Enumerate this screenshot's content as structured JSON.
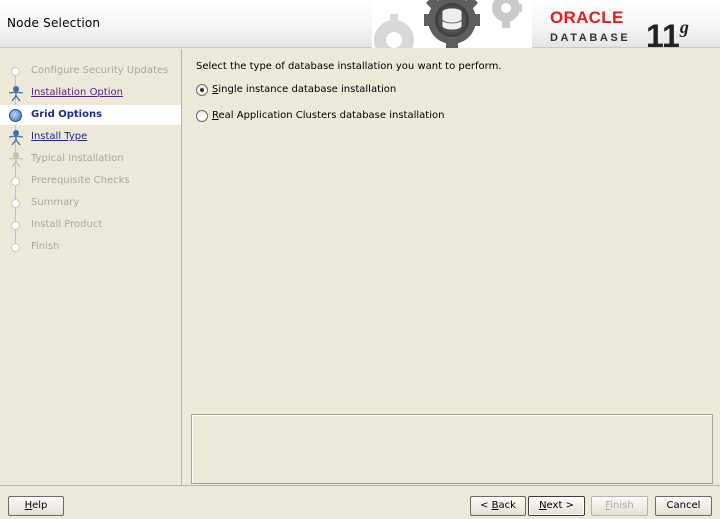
{
  "window": {
    "title": "Node Selection"
  },
  "brand": {
    "oracle": "ORACLE",
    "database": "DATABASE",
    "version": "11",
    "version_suffix": "g"
  },
  "nav": {
    "items": [
      {
        "label": "Configure Security Updates",
        "state": "disabled"
      },
      {
        "label": "Installation Option",
        "state": "visited"
      },
      {
        "label": "Grid Options",
        "state": "current"
      },
      {
        "label": "Install Type",
        "state": "link"
      },
      {
        "label": "Typical Installation",
        "state": "disabled"
      },
      {
        "label": "Prerequisite Checks",
        "state": "disabled"
      },
      {
        "label": "Summary",
        "state": "disabled"
      },
      {
        "label": "Install Product",
        "state": "disabled"
      },
      {
        "label": "Finish",
        "state": "disabled"
      }
    ]
  },
  "main": {
    "prompt": "Select the type of database installation you want to perform.",
    "options": [
      {
        "mnemonic": "S",
        "rest": "ingle instance database installation",
        "selected": true
      },
      {
        "mnemonic": "R",
        "rest": "eal Application Clusters database installation",
        "selected": false
      }
    ],
    "message": ""
  },
  "buttons": {
    "help_m": "H",
    "help_r": "elp",
    "back_pre": "< ",
    "back_m": "B",
    "back_r": "ack",
    "next_m": "N",
    "next_r": "ext >",
    "finish_m": "F",
    "finish_r": "inish",
    "cancel": "Cancel"
  },
  "colors": {
    "oracle_red": "#e01f1f",
    "link_blue": "#1b2b8a",
    "visited_purple": "#5c1e8a",
    "background": "#ece9d8"
  }
}
